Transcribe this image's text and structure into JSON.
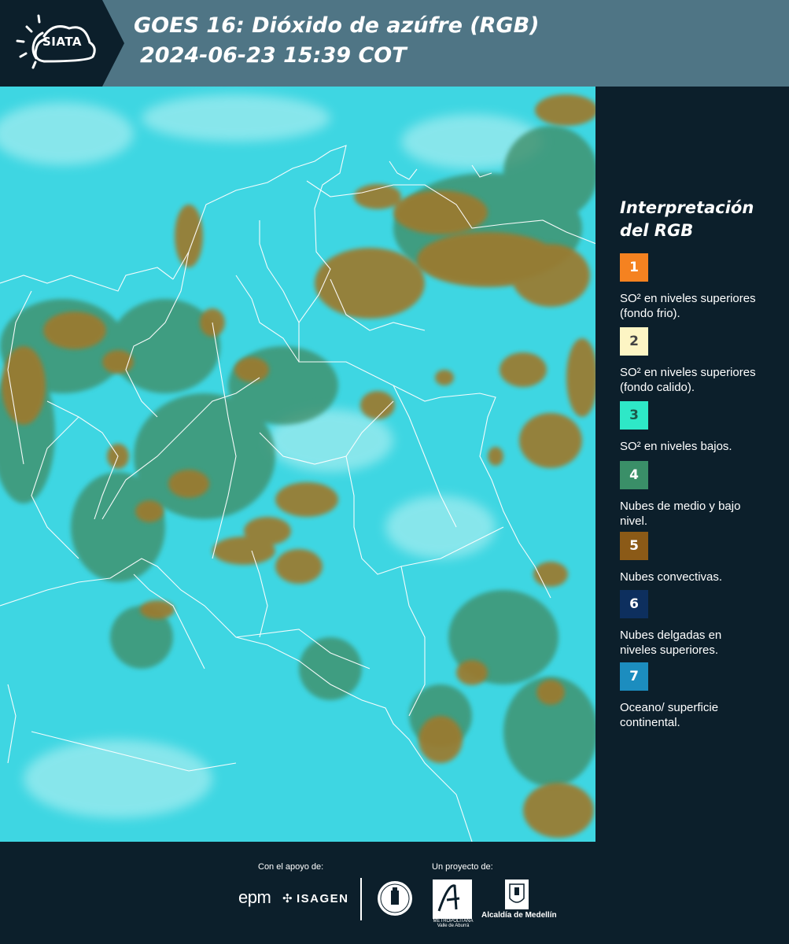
{
  "header": {
    "logo_text": "SIATA",
    "title_line1": "GOES 16: Dióxido de azúfre (RGB)",
    "title_line2": "2024-06-23 15:39 COT"
  },
  "map": {
    "background_color": "#3ed6e2",
    "cloud_color": "#9c7a2e",
    "low_cloud_color": "#3f8f6a",
    "border_color": "#ffffff"
  },
  "legend": {
    "title_line1": "Interpretación",
    "title_line2": "del RGB",
    "items": [
      {
        "number": "1",
        "color": "#f58220",
        "text_color": "#ffffff",
        "label": "SO² en niveles superiores (fondo frio)."
      },
      {
        "number": "2",
        "color": "#fdf5c4",
        "text_color": "#444444",
        "label": "SO² en niveles superiores (fondo calido)."
      },
      {
        "number": "3",
        "color": "#2ee8c7",
        "text_color": "#1c5a4a",
        "label": "SO² en niveles bajos."
      },
      {
        "number": "4",
        "color": "#3a8f68",
        "text_color": "#ffffff",
        "label": "Nubes de medio y bajo nivel."
      },
      {
        "number": "5",
        "color": "#8b5a17",
        "text_color": "#ffffff",
        "label": "Nubes convectivas."
      },
      {
        "number": "6",
        "color": "#0d2f5e",
        "text_color": "#ffffff",
        "label": "Nubes delgadas en niveles superiores."
      },
      {
        "number": "7",
        "color": "#1c8dbf",
        "text_color": "#ffffff",
        "label": "Oceano/ superficie continental."
      }
    ]
  },
  "footer": {
    "support_label": "Con el apoyo de:",
    "project_label": "Un proyecto de:",
    "epm": "epm",
    "isagen": "ISAGEN",
    "area_text": "METROPOLITANA Valle de Aburrá",
    "alcaldia": "Alcaldía de Medellín"
  }
}
